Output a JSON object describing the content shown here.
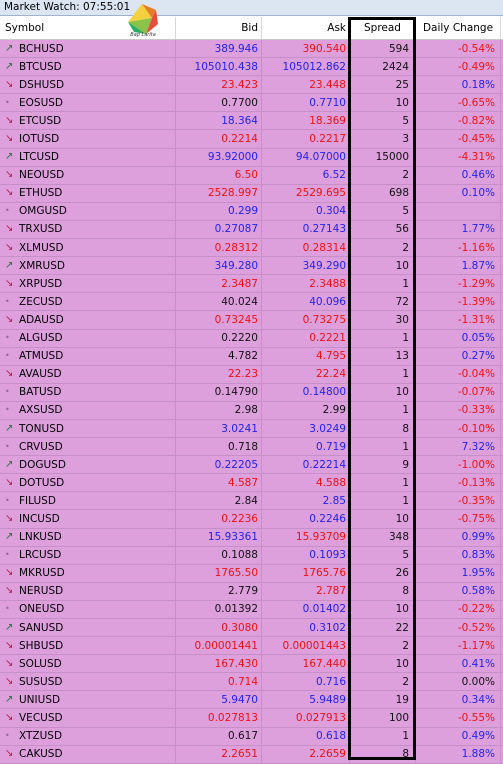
{
  "window": {
    "title": "Market Watch: 07:55:01"
  },
  "logo": {
    "icon": "colorful-square-logo-icon",
    "caption": "Bap Larita"
  },
  "columns": {
    "symbol": "Symbol",
    "bid": "Bid",
    "ask": "Ask",
    "spread": "Spread",
    "daily_change": "Daily Change"
  },
  "colors": {
    "row_background": "#dda0dd",
    "price_up": "#2222ee",
    "price_down": "#ee1111",
    "change_positive": "#2222ee",
    "change_negative": "#ee1111",
    "spread_highlight_border": "#000000"
  },
  "rows": [
    {
      "symbol": "BCHUSD",
      "dir": "up",
      "bid": "389.946",
      "ask": "390.540",
      "spread": "594",
      "change": "-0.54%",
      "bid_color": "blue",
      "ask_color": "red",
      "change_color": "red"
    },
    {
      "symbol": "BTCUSD",
      "dir": "up",
      "bid": "105010.438",
      "ask": "105012.862",
      "spread": "2424",
      "change": "-0.49%",
      "bid_color": "blue",
      "ask_color": "blue",
      "change_color": "red"
    },
    {
      "symbol": "DSHUSD",
      "dir": "down",
      "bid": "23.423",
      "ask": "23.448",
      "spread": "25",
      "change": "0.18%",
      "bid_color": "red",
      "ask_color": "red",
      "change_color": "blue"
    },
    {
      "symbol": "EOSUSD",
      "dir": "flat",
      "bid": "0.7700",
      "ask": "0.7710",
      "spread": "10",
      "change": "-0.65%",
      "bid_color": "black",
      "ask_color": "blue",
      "change_color": "red"
    },
    {
      "symbol": "ETCUSD",
      "dir": "down",
      "bid": "18.364",
      "ask": "18.369",
      "spread": "5",
      "change": "-0.82%",
      "bid_color": "blue",
      "ask_color": "red",
      "change_color": "red"
    },
    {
      "symbol": "IOTUSD",
      "dir": "down",
      "bid": "0.2214",
      "ask": "0.2217",
      "spread": "3",
      "change": "-0.45%",
      "bid_color": "red",
      "ask_color": "red",
      "change_color": "red"
    },
    {
      "symbol": "LTCUSD",
      "dir": "up",
      "bid": "93.92000",
      "ask": "94.07000",
      "spread": "15000",
      "change": "-4.31%",
      "bid_color": "blue",
      "ask_color": "blue",
      "change_color": "red"
    },
    {
      "symbol": "NEOUSD",
      "dir": "down",
      "bid": "6.50",
      "ask": "6.52",
      "spread": "2",
      "change": "0.46%",
      "bid_color": "red",
      "ask_color": "blue",
      "change_color": "blue"
    },
    {
      "symbol": "ETHUSD",
      "dir": "down",
      "bid": "2528.997",
      "ask": "2529.695",
      "spread": "698",
      "change": "0.10%",
      "bid_color": "red",
      "ask_color": "red",
      "change_color": "blue"
    },
    {
      "symbol": "OMGUSD",
      "dir": "flat",
      "bid": "0.299",
      "ask": "0.304",
      "spread": "5",
      "change": "",
      "bid_color": "blue",
      "ask_color": "blue",
      "change_color": "blue"
    },
    {
      "symbol": "TRXUSD",
      "dir": "down",
      "bid": "0.27087",
      "ask": "0.27143",
      "spread": "56",
      "change": "1.77%",
      "bid_color": "blue",
      "ask_color": "blue",
      "change_color": "blue"
    },
    {
      "symbol": "XLMUSD",
      "dir": "down",
      "bid": "0.28312",
      "ask": "0.28314",
      "spread": "2",
      "change": "-1.16%",
      "bid_color": "red",
      "ask_color": "red",
      "change_color": "red"
    },
    {
      "symbol": "XMRUSD",
      "dir": "up",
      "bid": "349.280",
      "ask": "349.290",
      "spread": "10",
      "change": "1.87%",
      "bid_color": "blue",
      "ask_color": "blue",
      "change_color": "blue"
    },
    {
      "symbol": "XRPUSD",
      "dir": "down",
      "bid": "2.3487",
      "ask": "2.3488",
      "spread": "1",
      "change": "-1.29%",
      "bid_color": "red",
      "ask_color": "red",
      "change_color": "red"
    },
    {
      "symbol": "ZECUSD",
      "dir": "flat",
      "bid": "40.024",
      "ask": "40.096",
      "spread": "72",
      "change": "-1.39%",
      "bid_color": "black",
      "ask_color": "blue",
      "change_color": "red"
    },
    {
      "symbol": "ADAUSD",
      "dir": "down",
      "bid": "0.73245",
      "ask": "0.73275",
      "spread": "30",
      "change": "-1.31%",
      "bid_color": "red",
      "ask_color": "red",
      "change_color": "red"
    },
    {
      "symbol": "ALGUSD",
      "dir": "flat",
      "bid": "0.2220",
      "ask": "0.2221",
      "spread": "1",
      "change": "0.05%",
      "bid_color": "black",
      "ask_color": "red",
      "change_color": "blue"
    },
    {
      "symbol": "ATMUSD",
      "dir": "flat",
      "bid": "4.782",
      "ask": "4.795",
      "spread": "13",
      "change": "0.27%",
      "bid_color": "black",
      "ask_color": "red",
      "change_color": "blue"
    },
    {
      "symbol": "AVAUSD",
      "dir": "down",
      "bid": "22.23",
      "ask": "22.24",
      "spread": "1",
      "change": "-0.04%",
      "bid_color": "red",
      "ask_color": "red",
      "change_color": "red"
    },
    {
      "symbol": "BATUSD",
      "dir": "flat",
      "bid": "0.14790",
      "ask": "0.14800",
      "spread": "10",
      "change": "-0.07%",
      "bid_color": "black",
      "ask_color": "blue",
      "change_color": "red"
    },
    {
      "symbol": "AXSUSD",
      "dir": "flat",
      "bid": "2.98",
      "ask": "2.99",
      "spread": "1",
      "change": "-0.33%",
      "bid_color": "black",
      "ask_color": "black",
      "change_color": "red"
    },
    {
      "symbol": "TONUSD",
      "dir": "up",
      "bid": "3.0241",
      "ask": "3.0249",
      "spread": "8",
      "change": "-0.10%",
      "bid_color": "blue",
      "ask_color": "blue",
      "change_color": "red"
    },
    {
      "symbol": "CRVUSD",
      "dir": "flat",
      "bid": "0.718",
      "ask": "0.719",
      "spread": "1",
      "change": "7.32%",
      "bid_color": "black",
      "ask_color": "blue",
      "change_color": "blue"
    },
    {
      "symbol": "DOGUSD",
      "dir": "up",
      "bid": "0.22205",
      "ask": "0.22214",
      "spread": "9",
      "change": "-1.00%",
      "bid_color": "blue",
      "ask_color": "blue",
      "change_color": "red"
    },
    {
      "symbol": "DOTUSD",
      "dir": "down",
      "bid": "4.587",
      "ask": "4.588",
      "spread": "1",
      "change": "-0.13%",
      "bid_color": "red",
      "ask_color": "red",
      "change_color": "red"
    },
    {
      "symbol": "FILUSD",
      "dir": "flat",
      "bid": "2.84",
      "ask": "2.85",
      "spread": "1",
      "change": "-0.35%",
      "bid_color": "black",
      "ask_color": "blue",
      "change_color": "red"
    },
    {
      "symbol": "INCUSD",
      "dir": "down",
      "bid": "0.2236",
      "ask": "0.2246",
      "spread": "10",
      "change": "-0.75%",
      "bid_color": "red",
      "ask_color": "blue",
      "change_color": "red"
    },
    {
      "symbol": "LNKUSD",
      "dir": "up",
      "bid": "15.93361",
      "ask": "15.93709",
      "spread": "348",
      "change": "0.99%",
      "bid_color": "blue",
      "ask_color": "red",
      "change_color": "blue"
    },
    {
      "symbol": "LRCUSD",
      "dir": "flat",
      "bid": "0.1088",
      "ask": "0.1093",
      "spread": "5",
      "change": "0.83%",
      "bid_color": "black",
      "ask_color": "blue",
      "change_color": "blue"
    },
    {
      "symbol": "MKRUSD",
      "dir": "down",
      "bid": "1765.50",
      "ask": "1765.76",
      "spread": "26",
      "change": "1.95%",
      "bid_color": "red",
      "ask_color": "red",
      "change_color": "blue"
    },
    {
      "symbol": "NERUSD",
      "dir": "down",
      "bid": "2.779",
      "ask": "2.787",
      "spread": "8",
      "change": "0.58%",
      "bid_color": "black",
      "ask_color": "red",
      "change_color": "blue"
    },
    {
      "symbol": "ONEUSD",
      "dir": "flat",
      "bid": "0.01392",
      "ask": "0.01402",
      "spread": "10",
      "change": "-0.22%",
      "bid_color": "black",
      "ask_color": "blue",
      "change_color": "red"
    },
    {
      "symbol": "SANUSD",
      "dir": "up",
      "bid": "0.3080",
      "ask": "0.3102",
      "spread": "22",
      "change": "-0.52%",
      "bid_color": "red",
      "ask_color": "blue",
      "change_color": "red"
    },
    {
      "symbol": "SHBUSD",
      "dir": "down",
      "bid": "0.00001441",
      "ask": "0.00001443",
      "spread": "2",
      "change": "-1.17%",
      "bid_color": "red",
      "ask_color": "red",
      "change_color": "red"
    },
    {
      "symbol": "SOLUSD",
      "dir": "down",
      "bid": "167.430",
      "ask": "167.440",
      "spread": "10",
      "change": "0.41%",
      "bid_color": "red",
      "ask_color": "red",
      "change_color": "blue"
    },
    {
      "symbol": "SUSUSD",
      "dir": "down",
      "bid": "0.714",
      "ask": "0.716",
      "spread": "2",
      "change": "0.00%",
      "bid_color": "red",
      "ask_color": "blue",
      "change_color": "black"
    },
    {
      "symbol": "UNIUSD",
      "dir": "up",
      "bid": "5.9470",
      "ask": "5.9489",
      "spread": "19",
      "change": "0.34%",
      "bid_color": "blue",
      "ask_color": "blue",
      "change_color": "blue"
    },
    {
      "symbol": "VECUSD",
      "dir": "down",
      "bid": "0.027813",
      "ask": "0.027913",
      "spread": "100",
      "change": "-0.55%",
      "bid_color": "red",
      "ask_color": "red",
      "change_color": "red"
    },
    {
      "symbol": "XTZUSD",
      "dir": "flat",
      "bid": "0.617",
      "ask": "0.618",
      "spread": "1",
      "change": "0.49%",
      "bid_color": "black",
      "ask_color": "blue",
      "change_color": "blue"
    },
    {
      "symbol": "CAKUSD",
      "dir": "down",
      "bid": "2.2651",
      "ask": "2.2659",
      "spread": "8",
      "change": "1.88%",
      "bid_color": "red",
      "ask_color": "red",
      "change_color": "blue"
    }
  ]
}
